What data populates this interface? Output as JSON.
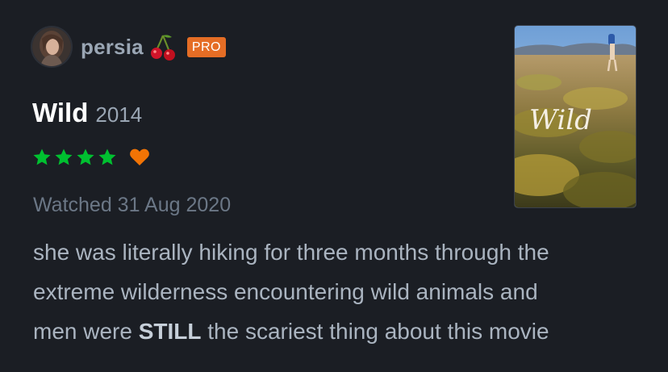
{
  "author": {
    "username": "persia",
    "emoji_icon": "cherries-icon",
    "badge": "PRO",
    "badge_color": "#e56d25"
  },
  "film": {
    "title": "Wild",
    "year": "2014",
    "poster_title": "Wild"
  },
  "rating": {
    "stars": 4,
    "max_stars": 5,
    "star_color": "#00c030",
    "liked": true,
    "heart_color": "#f27405"
  },
  "watched": "Watched 31 Aug 2020",
  "review": {
    "line1": "she was literally hiking for three months through the",
    "line2": "extreme wilderness encountering wild animals and",
    "line3_pre": "men were",
    "line3_bold": "STILL",
    "line3_post": "the scariest thing about this movie"
  }
}
